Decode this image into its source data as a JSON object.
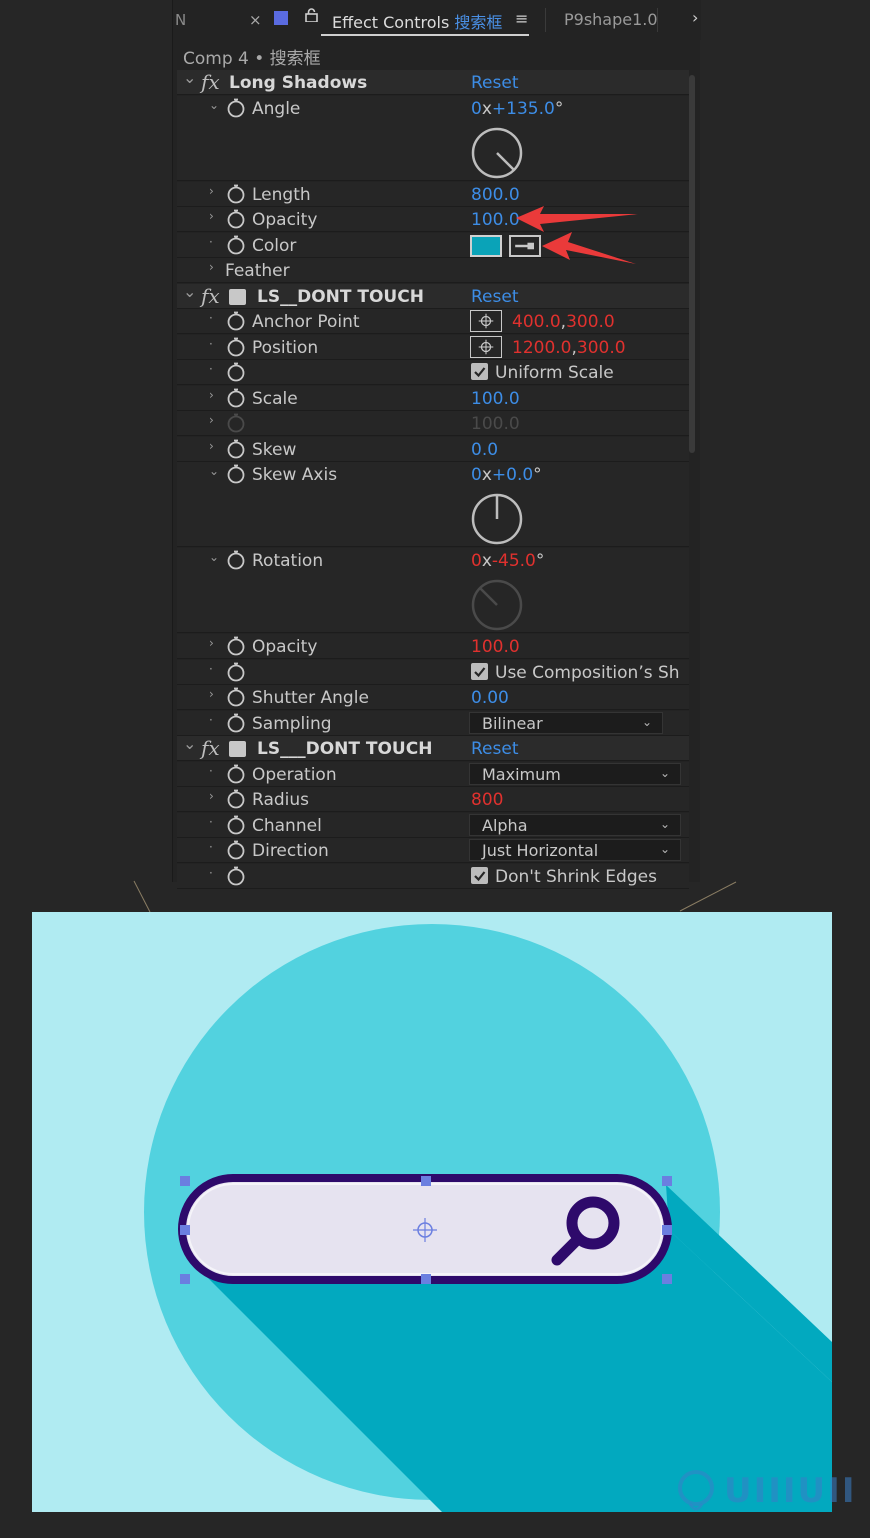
{
  "tabbar": {
    "left_tab_label": "N",
    "close_glyph": "×",
    "panel_title": "Effect Controls",
    "panel_title_target": "搜索框",
    "menu_glyph": "≡",
    "other_tab_label": "P9shape1.0",
    "more_glyph": "›",
    "swatch_color": "#5a6be0"
  },
  "comp_path": "Comp 4 • 搜索框",
  "rows": [
    {
      "kind": "effect",
      "name": "Long Shadows",
      "reset": "Reset"
    },
    {
      "kind": "dial",
      "name": "Angle",
      "rev": "0",
      "rev_x": "x",
      "deg": "+135.0",
      "deg_sym": "°",
      "color": "blue",
      "dial_angle": 135
    },
    {
      "kind": "value",
      "name": "Length",
      "value": "800.0",
      "color": "blue"
    },
    {
      "kind": "value",
      "name": "Opacity",
      "value": "100.0",
      "color": "blue"
    },
    {
      "kind": "color",
      "name": "Color",
      "swatch": "#0aa3b8"
    },
    {
      "kind": "group",
      "name": "Feather"
    },
    {
      "kind": "effect",
      "name": "LS__DONT TOUCH",
      "reset": "Reset"
    },
    {
      "kind": "point",
      "name": "Anchor Point",
      "value": "400.0",
      "value2": "300.0"
    },
    {
      "kind": "point",
      "name": "Position",
      "value": "1200.0",
      "value2": "300.0"
    },
    {
      "kind": "check",
      "name": "",
      "label": "Uniform Scale"
    },
    {
      "kind": "value",
      "name": "Scale",
      "value": "100.0",
      "color": "blue"
    },
    {
      "kind": "value",
      "name": "",
      "value": "100.0",
      "color": "dim"
    },
    {
      "kind": "value",
      "name": "Skew",
      "value": "0.0",
      "color": "blue"
    },
    {
      "kind": "dial",
      "name": "Skew Axis",
      "rev": "0",
      "rev_x": "x",
      "deg": "+0.0",
      "deg_sym": "°",
      "color": "blue",
      "dial_angle": 0
    },
    {
      "kind": "dial",
      "name": "Rotation",
      "rev": "0",
      "rev_x": "x",
      "deg": "-45.0",
      "deg_sym": "°",
      "color": "red",
      "dial_angle": -45
    },
    {
      "kind": "value",
      "name": "Opacity",
      "value": "100.0",
      "color": "red"
    },
    {
      "kind": "check",
      "name": "",
      "label": "Use Composition’s Sh"
    },
    {
      "kind": "value",
      "name": "Shutter Angle",
      "value": "0.00",
      "color": "blue"
    },
    {
      "kind": "dropdown",
      "name": "Sampling",
      "value": "Bilinear"
    },
    {
      "kind": "effect",
      "name": "LS___DONT TOUCH",
      "reset": "Reset"
    },
    {
      "kind": "dropdown",
      "name": "Operation",
      "value": "Maximum"
    },
    {
      "kind": "value",
      "name": "Radius",
      "value": "800",
      "color": "red"
    },
    {
      "kind": "dropdown",
      "name": "Channel",
      "value": "Alpha"
    },
    {
      "kind": "dropdown",
      "name": "Direction",
      "value": "Just Horizontal"
    },
    {
      "kind": "check",
      "name": "",
      "label": "Don't Shrink Edges"
    }
  ],
  "colors": {
    "viewport_bg": "#b0ebf2",
    "circle": "#52d2df",
    "shadow": "#02a9bf",
    "bar_fill": "#e6e3f0",
    "bar_stroke": "#2e0a6b",
    "handle": "#6b7fe0",
    "arrow": "#ea3a3a"
  },
  "watermark": "UIIIUII",
  "icons": [
    "stopwatch-icon",
    "fx-icon",
    "gear-icon",
    "search-icon",
    "eyedropper-icon",
    "target-icon",
    "lock-icon"
  ]
}
